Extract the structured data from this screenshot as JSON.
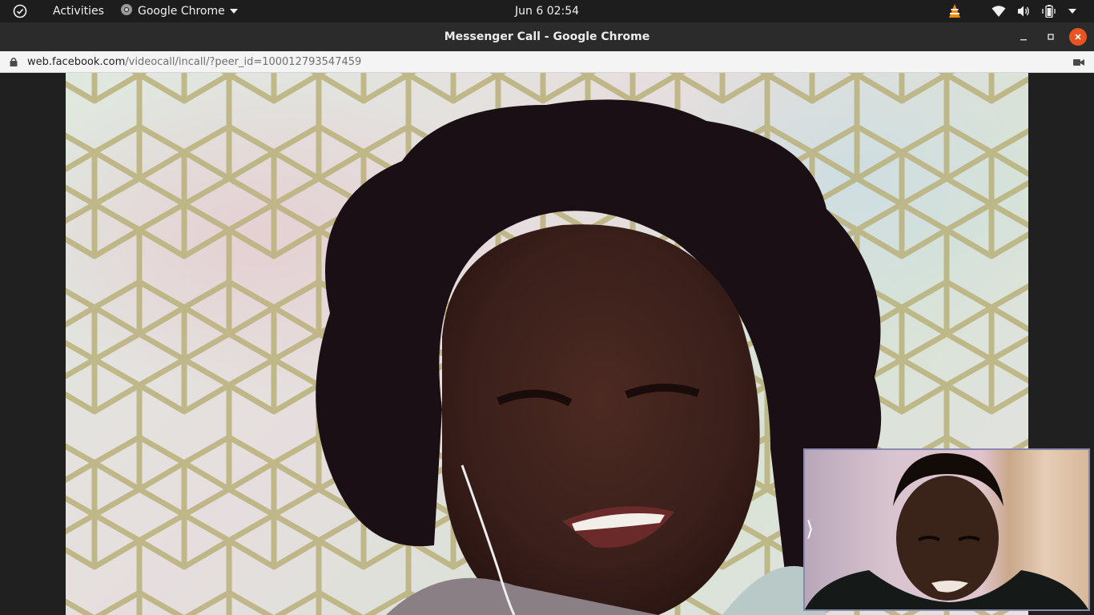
{
  "topbar": {
    "activities_label": "Activities",
    "app_label": "Google Chrome",
    "clock_date": "Jun 6",
    "clock_time": "02:54",
    "tray_icons": [
      "vlc-icon",
      "wifi-icon",
      "volume-icon",
      "battery-icon"
    ]
  },
  "window": {
    "title": "Messenger Call - Google Chrome"
  },
  "address": {
    "domain": "web.facebook.com",
    "path": "/videocall/incall/?peer_id=100012793547459"
  },
  "call": {
    "pip_toggle_glyph": "⟩"
  },
  "colors": {
    "topbar_bg": "#1d1d1d",
    "titlebar_bg": "#2b2b2b",
    "close_button": "#e95420",
    "stage_bg": "#202020"
  }
}
